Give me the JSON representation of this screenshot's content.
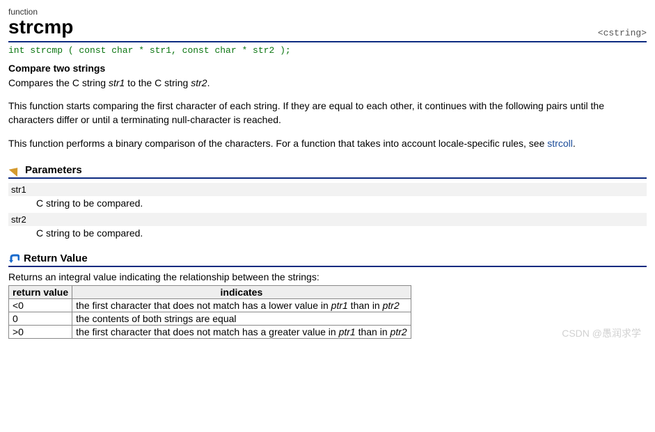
{
  "header": {
    "category": "function",
    "name": "strcmp",
    "header_tag": "<cstring>"
  },
  "signature": "int strcmp ( const char * str1, const char * str2 );",
  "subtitle": "Compare two strings",
  "desc": {
    "p1_a": "Compares the C string ",
    "p1_i1": "str1",
    "p1_b": " to the C string ",
    "p1_i2": "str2",
    "p1_c": ".",
    "p2": "This function starts comparing the first character of each string. If they are equal to each other, it continues with the following pairs until the characters differ or until a terminating null-character is reached.",
    "p3_a": "This function performs a binary comparison of the characters. For a function that takes into account locale-specific rules, see ",
    "p3_link": "strcoll",
    "p3_b": "."
  },
  "sections": {
    "parameters": "Parameters",
    "return": "Return Value"
  },
  "params": [
    {
      "name": "str1",
      "desc": "C string to be compared."
    },
    {
      "name": "str2",
      "desc": "C string to be compared."
    }
  ],
  "ret": {
    "intro": "Returns an integral value indicating the relationship between the strings:",
    "headers": {
      "col1": "return value",
      "col2": "indicates"
    },
    "rows": [
      {
        "val": "<0",
        "pre": "the first character that does not match has a lower value in ",
        "i1": "ptr1",
        "mid": " than in ",
        "i2": "ptr2"
      },
      {
        "val": "0",
        "pre": "the contents of both strings are equal",
        "i1": "",
        "mid": "",
        "i2": ""
      },
      {
        "val": ">0",
        "pre": "the first character that does not match has a greater value in ",
        "i1": "ptr1",
        "mid": " than in ",
        "i2": "ptr2"
      }
    ]
  },
  "watermark": "CSDN @愚润求学"
}
